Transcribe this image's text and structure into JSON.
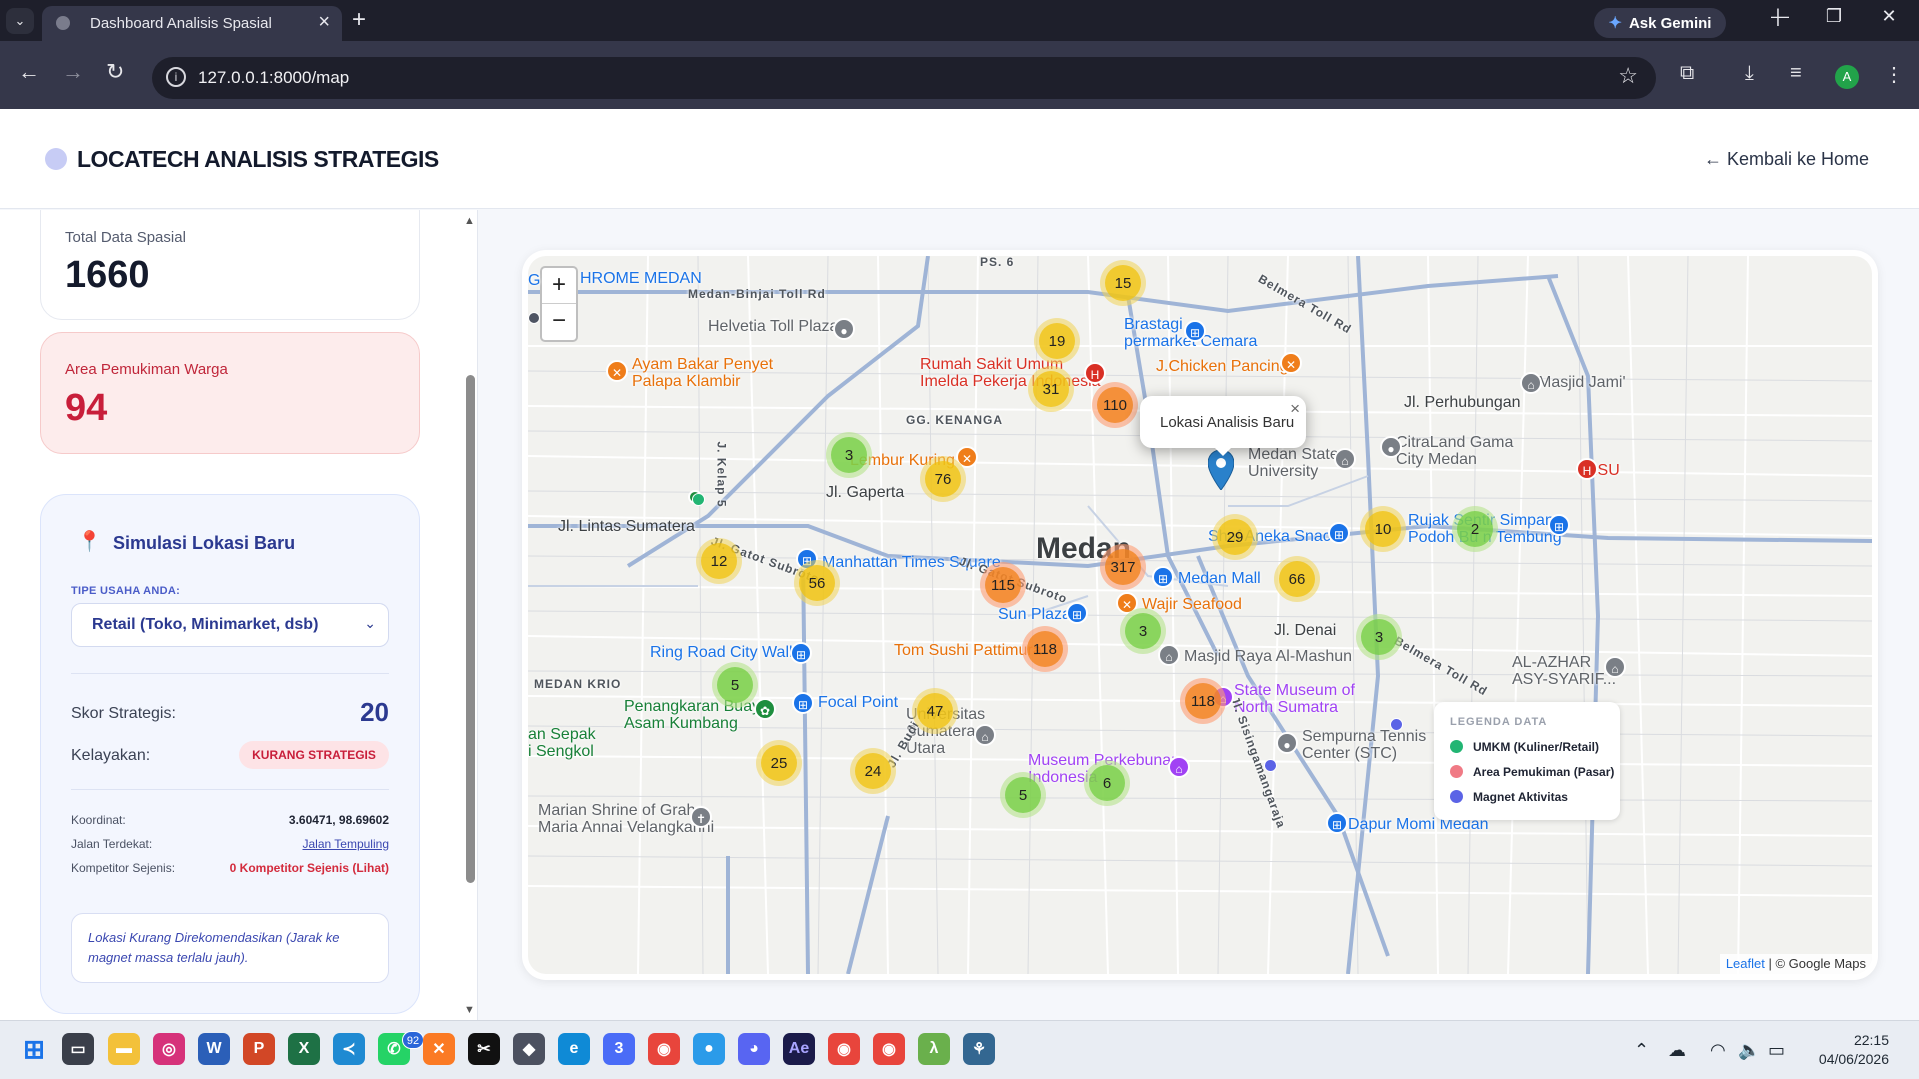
{
  "browser": {
    "tab_title": "Dashboard Analisis Spasial",
    "gemini_label": "Ask Gemini",
    "url": "127.0.0.1:8000/map",
    "profile_initial": "A"
  },
  "header": {
    "brand": "LOCATECH ANALISIS STRATEGIS",
    "back_link": "← Kembali ke Home"
  },
  "stats": {
    "total_label": "Total Data Spasial",
    "total_value": "1660",
    "residential_label": "Area Pemukiman Warga",
    "residential_value": "94"
  },
  "simulation": {
    "title": "Simulasi Lokasi Baru",
    "type_label": "TIPE USAHA ANDA:",
    "type_value": "Retail (Toko, Minimarket, dsb)",
    "score_label": "Skor Strategis:",
    "score_value": "20",
    "feasibility_label": "Kelayakan:",
    "feasibility_value": "KURANG STRATEGIS",
    "coord_label": "Koordinat:",
    "coord_value": "3.60471, 98.69602",
    "road_label": "Jalan Terdekat:",
    "road_value": "Jalan Tempuling",
    "competitor_label": "Kompetitor Sejenis:",
    "competitor_value": "0 Kompetitor Sejenis (Lihat)",
    "note": "Lokasi Kurang Direkomendasikan (Jarak ke magnet massa terlalu jauh)."
  },
  "map": {
    "zoom_in": "+",
    "zoom_out": "−",
    "city_label": "Medan",
    "popup_text": "Lokasi Analisis Baru",
    "popup_close": "×",
    "places": [
      {
        "text": "HROME MEDAN",
        "cls": "p-blue"
      },
      {
        "text": "Medan-Binjai Toll Rd",
        "cls": "p-road"
      },
      {
        "text": "Helvetia Toll Plaza",
        "cls": "p-gray"
      },
      {
        "text": "Ayam Bakar Penyet\nPalapa Klambir",
        "cls": "p-orange"
      },
      {
        "text": "Brastagi\npermarket Cemara",
        "cls": "p-blue"
      },
      {
        "text": "Rumah Sakit Umum\nImelda Pekerja Indonesia",
        "cls": "p-red"
      },
      {
        "text": "J.Chicken Pancing",
        "cls": "p-orange"
      },
      {
        "text": "Masjid Jami'",
        "cls": "p-gray"
      },
      {
        "text": "Jl. Perhubungan",
        "cls": "p-dark"
      },
      {
        "text": "GG. KENANGA",
        "cls": "p-road"
      },
      {
        "text": "CitraLand Gama\nCity Medan",
        "cls": "p-gray"
      },
      {
        "text": "Medan State\nUniversity",
        "cls": "p-gray"
      },
      {
        "text": "Lembur Kuring",
        "cls": "p-orange"
      },
      {
        "text": "Jl. Gaperta",
        "cls": "p-dark"
      },
      {
        "text": "RSU",
        "cls": "p-red"
      },
      {
        "text": "Jl. Lintas Sumatera",
        "cls": "p-dark"
      },
      {
        "text": "Rujak Sentir Simpang\nPodoh Bu n Tembung",
        "cls": "p-blue"
      },
      {
        "text": "Shaf Aneka Snack",
        "cls": "p-blue"
      },
      {
        "text": "Manhattan Times Square",
        "cls": "p-blue"
      },
      {
        "text": "Medan Mall",
        "cls": "p-blue"
      },
      {
        "text": "Wajir Seafood",
        "cls": "p-orange"
      },
      {
        "text": "Sun Plaza",
        "cls": "p-blue"
      },
      {
        "text": "Jl. Denai",
        "cls": "p-dark"
      },
      {
        "text": "Ring Road City Walks",
        "cls": "p-blue"
      },
      {
        "text": "Tom Sushi Pattimura",
        "cls": "p-orange"
      },
      {
        "text": "Masjid Raya Al-Mashun",
        "cls": "p-gray"
      },
      {
        "text": "AL-AZHAR\nASY-SYARIF...",
        "cls": "p-gray"
      },
      {
        "text": "MEDAN KRIO",
        "cls": "p-road"
      },
      {
        "text": "Penangkaran Buaya\nAsam Kumbang",
        "cls": "p-green"
      },
      {
        "text": "Focal Point",
        "cls": "p-blue"
      },
      {
        "text": "State Museum of\nNorth Sumatra",
        "cls": "p-purple"
      },
      {
        "text": "an Sepak\ni Sengkol",
        "cls": "p-green"
      },
      {
        "text": "Universitas\nSumatera\nUtara",
        "cls": "p-gray"
      },
      {
        "text": "Sempurna Tennis\nCenter (STC)",
        "cls": "p-gray"
      },
      {
        "text": "Museum Perkebunan\nIndonesia",
        "cls": "p-purple"
      },
      {
        "text": "Marian Shrine of Graha\nMaria Annai Velangkanni",
        "cls": "p-gray"
      },
      {
        "text": "Dapur Momi Medan",
        "cls": "p-blue"
      },
      {
        "text": "PS. 6",
        "cls": "p-road"
      },
      {
        "text": "Belmera Toll Rd",
        "cls": "p-road"
      },
      {
        "text": "J. Kelap 5",
        "cls": "p-road"
      },
      {
        "text": "Jl. Gatot Subroto",
        "cls": "p-road"
      },
      {
        "text": "Jl. Sisingamangaraja",
        "cls": "p-road"
      },
      {
        "text": "Belmera Toll Rd",
        "cls": "p-road"
      },
      {
        "text": "Jl. Budi",
        "cls": "p-road"
      },
      {
        "text": "Jl. Gatot Subroto",
        "cls": "p-road"
      },
      {
        "text": "G",
        "cls": "p-blue"
      }
    ],
    "clusters": [
      {
        "label": "15",
        "tone": "y"
      },
      {
        "label": "19",
        "tone": "y"
      },
      {
        "label": "31",
        "tone": "y"
      },
      {
        "label": "110",
        "tone": "o"
      },
      {
        "label": "3",
        "tone": "g"
      },
      {
        "label": "76",
        "tone": "y"
      },
      {
        "label": "29",
        "tone": "y"
      },
      {
        "label": "10",
        "tone": "y"
      },
      {
        "label": "2",
        "tone": "g"
      },
      {
        "label": "12",
        "tone": "y"
      },
      {
        "label": "56",
        "tone": "y"
      },
      {
        "label": "115",
        "tone": "o"
      },
      {
        "label": "317",
        "tone": "o"
      },
      {
        "label": "66",
        "tone": "y"
      },
      {
        "label": "3",
        "tone": "g"
      },
      {
        "label": "3",
        "tone": "g"
      },
      {
        "label": "118",
        "tone": "o"
      },
      {
        "label": "5",
        "tone": "g"
      },
      {
        "label": "118",
        "tone": "o"
      },
      {
        "label": "47",
        "tone": "y"
      },
      {
        "label": "25",
        "tone": "y"
      },
      {
        "label": "24",
        "tone": "y"
      },
      {
        "label": "5",
        "tone": "g"
      },
      {
        "label": "6",
        "tone": "g"
      }
    ],
    "legend": {
      "title": "LEGENDA DATA",
      "items": [
        {
          "label": "UMKM (Kuliner/Retail)",
          "color": "#22b573"
        },
        {
          "label": "Area Pemukiman (Pasar)",
          "color": "#f07a85"
        },
        {
          "label": "Magnet Aktivitas",
          "color": "#5b63e6"
        }
      ]
    },
    "attribution_link": "Leaflet",
    "attribution_rest": " | © Google Maps"
  },
  "taskbar": {
    "whatsapp_badge": "92",
    "time": "22:15",
    "date": "04/06/2026"
  }
}
